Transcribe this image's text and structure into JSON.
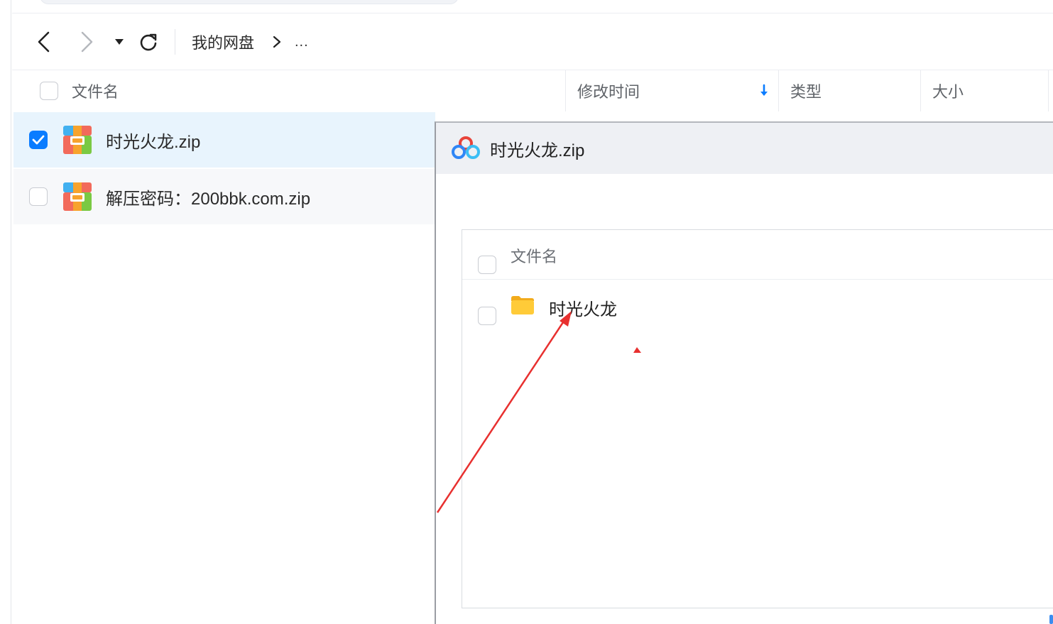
{
  "nav": {
    "breadcrumb_root": "我的网盘",
    "breadcrumb_sep": ">",
    "breadcrumb_more": "..."
  },
  "header": {
    "name": "文件名",
    "modified": "修改时间",
    "type": "类型",
    "size": "大小"
  },
  "files": [
    {
      "name": "时光火龙.zip",
      "selected": true,
      "icon": "zip-archive-icon"
    },
    {
      "name": "解压密码：200bbk.com.zip",
      "selected": false,
      "icon": "zip-archive-icon"
    }
  ],
  "preview": {
    "title": "时光火龙.zip",
    "header_label": "文件名",
    "items": [
      {
        "name": "时光火龙",
        "icon": "folder-icon"
      }
    ]
  },
  "colors": {
    "accent": "#0a7cff",
    "selected_row": "#e8f4fd",
    "annotation": "#e8302f",
    "folder": "#f7c02d"
  }
}
